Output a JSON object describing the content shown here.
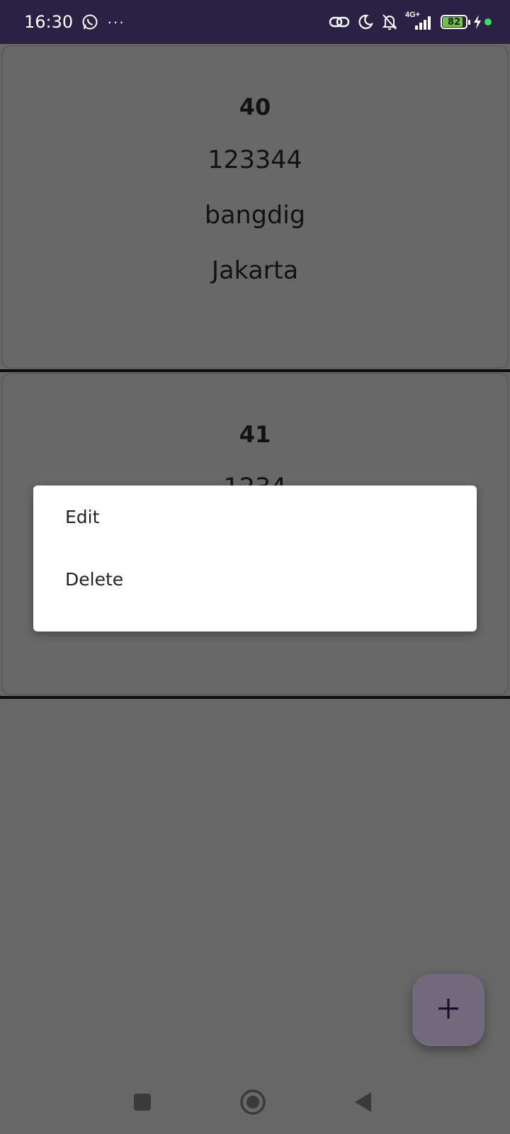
{
  "status_bar": {
    "time": "16:30",
    "dots": "···",
    "network_label": "4G+",
    "battery_level": "82",
    "colors": {
      "background": "#2a2244",
      "battery_fill": "#6fc24a",
      "indicator": "#3ddc6a"
    },
    "icons": [
      "whatsapp-icon",
      "more-notifications-icon",
      "link-icon",
      "do-not-disturb-moon-icon",
      "notifications-off-icon",
      "signal-icon",
      "battery-icon",
      "charging-bolt-icon",
      "active-dot-icon"
    ]
  },
  "records": [
    {
      "id": "40",
      "number": "123344",
      "name": "bangdig",
      "city": "Jakarta"
    },
    {
      "id": "41",
      "number": "1234"
    }
  ],
  "context_menu": {
    "items": [
      {
        "label": "Edit"
      },
      {
        "label": "Delete"
      }
    ]
  },
  "fab": {
    "icon": "plus-icon",
    "color": "#726a7c"
  },
  "nav_bar": {
    "icons": [
      "recents-square-icon",
      "home-circle-icon",
      "back-triangle-icon"
    ]
  }
}
